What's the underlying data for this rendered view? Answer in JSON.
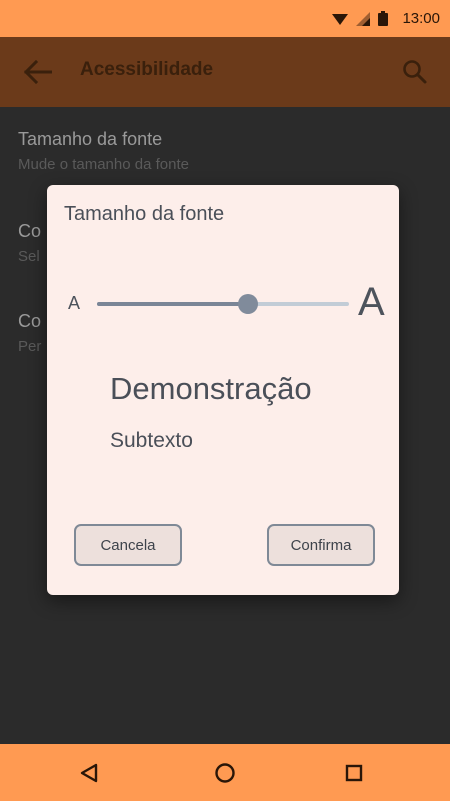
{
  "status_bar": {
    "time": "13:00",
    "icons": [
      "wifi-icon",
      "signal-icon",
      "battery-icon"
    ]
  },
  "app_bar": {
    "title": "Acessibilidade",
    "icons": [
      "back-arrow-icon",
      "search-icon"
    ]
  },
  "settings_list": [
    {
      "title": "Tamanho da fonte",
      "subtitle": "Mude o tamanho da fonte"
    },
    {
      "title": "Co",
      "subtitle": "Sel"
    },
    {
      "title": "Co",
      "subtitle": "Per"
    }
  ],
  "dialog": {
    "title": "Tamanho da fonte",
    "small_a": "A",
    "large_a": "A",
    "slider_level": 0.6,
    "preview_title": "Demonstração",
    "preview_subtitle": "Subtexto",
    "cancel_label": "Cancela",
    "confirm_label": "Confirma"
  },
  "nav_bar": {
    "icons": [
      "back-triangle-icon",
      "home-circle-icon",
      "recents-square-icon"
    ]
  },
  "colors": {
    "status_bar": "#ff9a52",
    "app_bar": "#6b3a1a",
    "dialog_bg": "#fdeeea",
    "accent": "#7a8596"
  }
}
